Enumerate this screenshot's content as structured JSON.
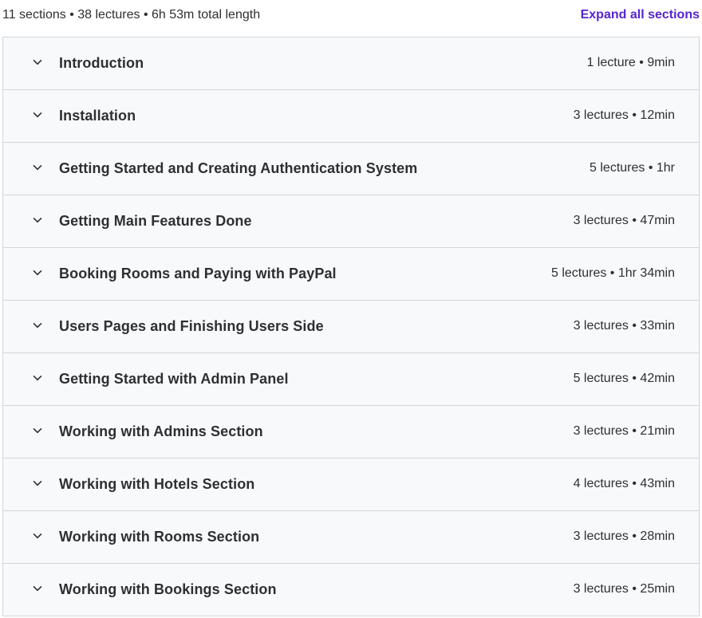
{
  "summary": {
    "text": "11 sections • 38 lectures • 6h 53m total length",
    "expand_label": "Expand all sections"
  },
  "colors": {
    "accent": "#5624d0",
    "section_bg": "#f7f9fa",
    "border": "#d1d7dc",
    "text": "#2d2f31"
  },
  "icons": {
    "section_toggle": "chevron-down-icon"
  },
  "sections": [
    {
      "title": "Introduction",
      "meta": "1 lecture • 9min"
    },
    {
      "title": "Installation",
      "meta": "3 lectures • 12min"
    },
    {
      "title": "Getting Started and Creating Authentication System",
      "meta": "5 lectures • 1hr"
    },
    {
      "title": "Getting Main Features Done",
      "meta": "3 lectures • 47min"
    },
    {
      "title": "Booking Rooms and Paying with PayPal",
      "meta": "5 lectures • 1hr 34min"
    },
    {
      "title": "Users Pages and Finishing Users Side",
      "meta": "3 lectures • 33min"
    },
    {
      "title": "Getting Started with Admin Panel",
      "meta": "5 lectures • 42min"
    },
    {
      "title": "Working with Admins Section",
      "meta": "3 lectures • 21min"
    },
    {
      "title": "Working with Hotels Section",
      "meta": "4 lectures • 43min"
    },
    {
      "title": "Working with Rooms Section",
      "meta": "3 lectures • 28min"
    },
    {
      "title": "Working with Bookings Section",
      "meta": "3 lectures • 25min"
    }
  ]
}
